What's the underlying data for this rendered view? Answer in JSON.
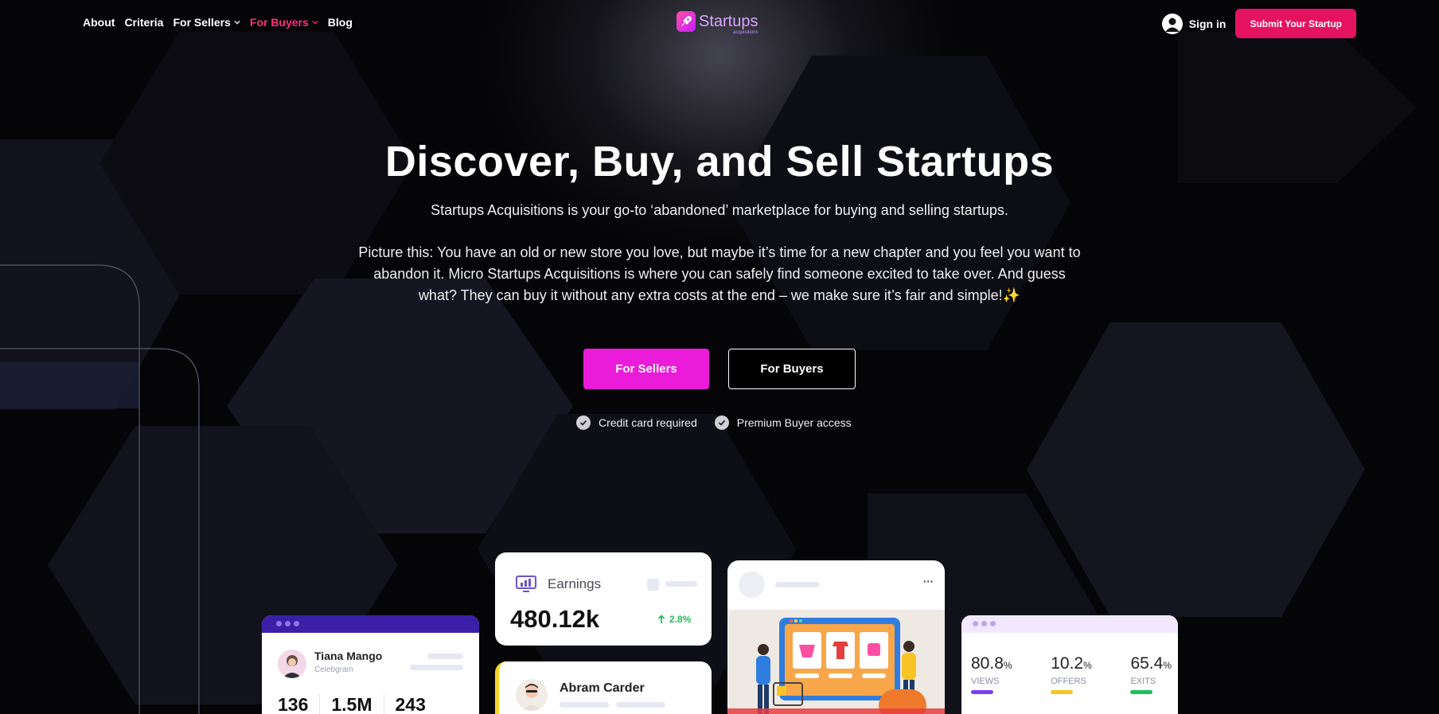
{
  "nav": {
    "links": [
      {
        "label": "About"
      },
      {
        "label": "Criteria"
      },
      {
        "label": "For Sellers"
      },
      {
        "label": "For Buyers"
      },
      {
        "label": "Blog"
      }
    ],
    "logo_text": "Startups",
    "logo_sub": "acquisitions",
    "sign_in": "Sign in",
    "submit": "Submit Your Startup"
  },
  "hero": {
    "title": "Discover, Buy, and Sell Startups",
    "subtitle": "Startups Acquisitions is your go-to ‘abandoned’ marketplace for buying and selling startups.",
    "paragraph": "Picture this: You have an old or new store you love, but maybe it’s time for a new chapter and you feel you want to abandon it. Micro Startups Acquisitions is where you can safely find someone excited to take over. And guess what? They can buy it without any extra costs at the end – we make sure it’s fair and simple!✨",
    "btn_sellers": "For Sellers",
    "btn_buyers": "For Buyers",
    "check1": "Credit card required",
    "check2": "Premium Buyer access"
  },
  "cards": {
    "profile": {
      "name": "Tiana Mango",
      "handle": "Celebgram",
      "stats": [
        "136",
        "1.5M",
        "243"
      ]
    },
    "earnings": {
      "label": "Earnings",
      "value": "480.12k",
      "change": "2.8%"
    },
    "person": {
      "name": "Abram Carder"
    },
    "post": {
      "more": "···"
    },
    "stats": {
      "items": [
        {
          "value": "80.8",
          "unit": "%",
          "label": "VIEWS",
          "color": "#7b3ff2"
        },
        {
          "value": "10.2",
          "unit": "%",
          "label": "OFFERS",
          "color": "#f7c325"
        },
        {
          "value": "65.4",
          "unit": "%",
          "label": "EXITS",
          "color": "#1fbf5b"
        }
      ]
    }
  },
  "colors": {
    "accent_pink": "#ea1bd9",
    "submit_red": "#e5135f",
    "active_nav": "#ff2d7a"
  }
}
